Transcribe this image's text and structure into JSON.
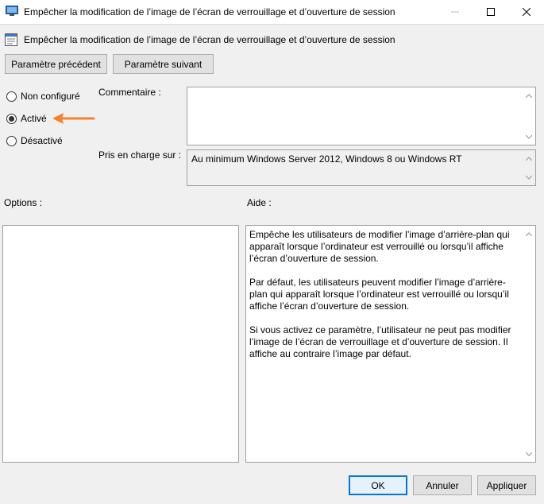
{
  "window": {
    "title": "Empêcher la modification de l’image de l’écran de verrouillage et d’ouverture de session",
    "controls": [
      "minimize",
      "maximize",
      "close"
    ]
  },
  "policy": {
    "title": "Empêcher la modification de l’image de l’écran de verrouillage et d’ouverture de session"
  },
  "nav": {
    "previous_label": "Paramètre précédent",
    "next_label": "Paramètre suivant"
  },
  "state": {
    "options": [
      {
        "label": "Non configuré",
        "selected": false
      },
      {
        "label": "Activé",
        "selected": true
      },
      {
        "label": "Désactivé",
        "selected": false
      }
    ]
  },
  "comment": {
    "label": "Commentaire :",
    "value": ""
  },
  "supported": {
    "label": "Pris en charge sur :",
    "value": "Au minimum Windows Server 2012, Windows 8 ou Windows RT"
  },
  "options_section": {
    "label": "Options :"
  },
  "help_section": {
    "label": "Aide :",
    "paragraphs": [
      "Empêche les utilisateurs de modifier l’image d’arrière-plan qui apparaît lorsque l’ordinateur est verrouillé ou lorsqu’il affiche l’écran d’ouverture de session.",
      "Par défaut, les utilisateurs peuvent modifier l’image d’arrière-plan qui apparaît lorsque l’ordinateur est verrouillé ou lorsqu’il affiche l’écran d’ouverture de session.",
      "Si vous activez ce paramètre, l’utilisateur ne peut pas modifier l’image de l’écran de verrouillage et d’ouverture de session. Il affiche au contraire l’image par défaut."
    ]
  },
  "footer": {
    "ok_label": "OK",
    "cancel_label": "Annuler",
    "apply_label": "Appliquer"
  },
  "colors": {
    "annotation_arrow": "#f5812b",
    "default_button_border": "#0078d7",
    "window_background": "#f0f0f0"
  }
}
